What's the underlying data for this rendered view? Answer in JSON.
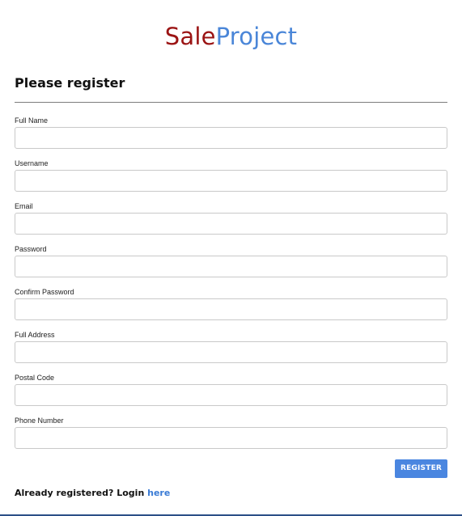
{
  "brand": {
    "part1": "Sale",
    "part2": "Project",
    "colors": {
      "part1": "#9b1414",
      "part2": "#4a86d8"
    }
  },
  "form": {
    "heading": "Please register",
    "fields": [
      {
        "label": "Full Name",
        "value": ""
      },
      {
        "label": "Username",
        "value": ""
      },
      {
        "label": "Email",
        "value": ""
      },
      {
        "label": "Password",
        "value": ""
      },
      {
        "label": "Confirm Password",
        "value": ""
      },
      {
        "label": "Full Address",
        "value": ""
      },
      {
        "label": "Postal Code",
        "value": ""
      },
      {
        "label": "Phone Number",
        "value": ""
      }
    ],
    "submit_label": "REGISTER",
    "submit_color": "#4a86e0"
  },
  "footer": {
    "prompt": "Already registered? Login ",
    "link_label": "here",
    "link_color": "#3a7bd5"
  }
}
